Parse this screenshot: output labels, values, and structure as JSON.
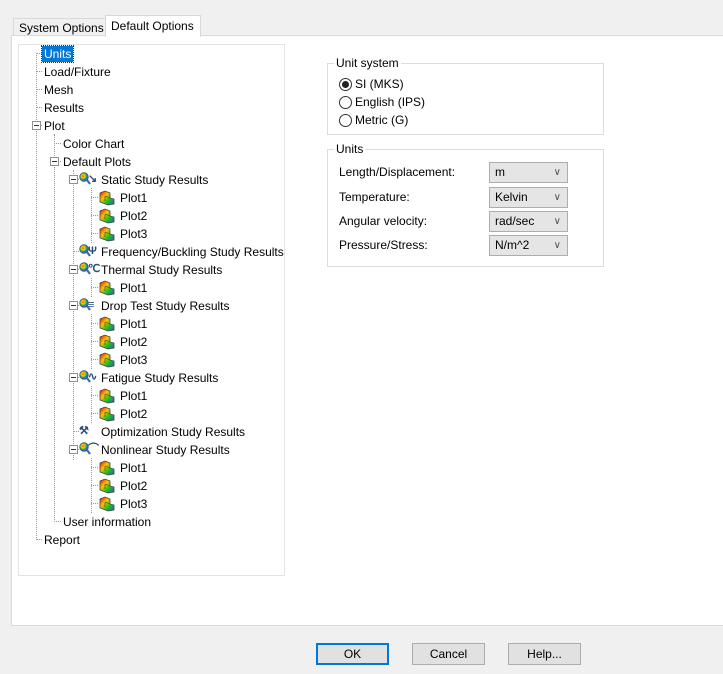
{
  "tabs": [
    {
      "label": "System Options",
      "active": false
    },
    {
      "label": "Default Options",
      "active": true
    }
  ],
  "tree": {
    "units": "Units",
    "load_fixture": "Load/Fixture",
    "mesh": "Mesh",
    "results": "Results",
    "plot": "Plot",
    "color_chart": "Color Chart",
    "default_plots": "Default Plots",
    "static": {
      "label": "Static Study Results",
      "plots": [
        "Plot1",
        "Plot2",
        "Plot3"
      ]
    },
    "frequency": {
      "label": "Frequency/Buckling Study Results"
    },
    "thermal": {
      "label": "Thermal Study Results",
      "plots": [
        "Plot1"
      ]
    },
    "drop_test": {
      "label": "Drop Test Study Results",
      "plots": [
        "Plot1",
        "Plot2",
        "Plot3"
      ]
    },
    "fatigue": {
      "label": "Fatigue Study Results",
      "plots": [
        "Plot1",
        "Plot2"
      ]
    },
    "optimization": {
      "label": "Optimization Study Results"
    },
    "nonlinear": {
      "label": "Nonlinear Study Results",
      "plots": [
        "Plot1",
        "Plot2",
        "Plot3"
      ]
    },
    "user_information": "User information",
    "report": "Report",
    "selected": "Units"
  },
  "unit_system": {
    "title": "Unit system",
    "options": [
      {
        "label": "SI (MKS)",
        "checked": true
      },
      {
        "label": "English (IPS)",
        "checked": false
      },
      {
        "label": "Metric (G)",
        "checked": false
      }
    ]
  },
  "units": {
    "title": "Units",
    "rows": [
      {
        "label": "Length/Displacement:",
        "value": "m"
      },
      {
        "label": "Temperature:",
        "value": "Kelvin"
      },
      {
        "label": "Angular velocity:",
        "value": "rad/sec"
      },
      {
        "label": "Pressure/Stress:",
        "value": "N/m^2"
      }
    ]
  },
  "buttons": {
    "ok": "OK",
    "cancel": "Cancel",
    "help": "Help..."
  },
  "colors": {
    "selection": "#0078d7",
    "default_button_border": "#0078d7"
  }
}
